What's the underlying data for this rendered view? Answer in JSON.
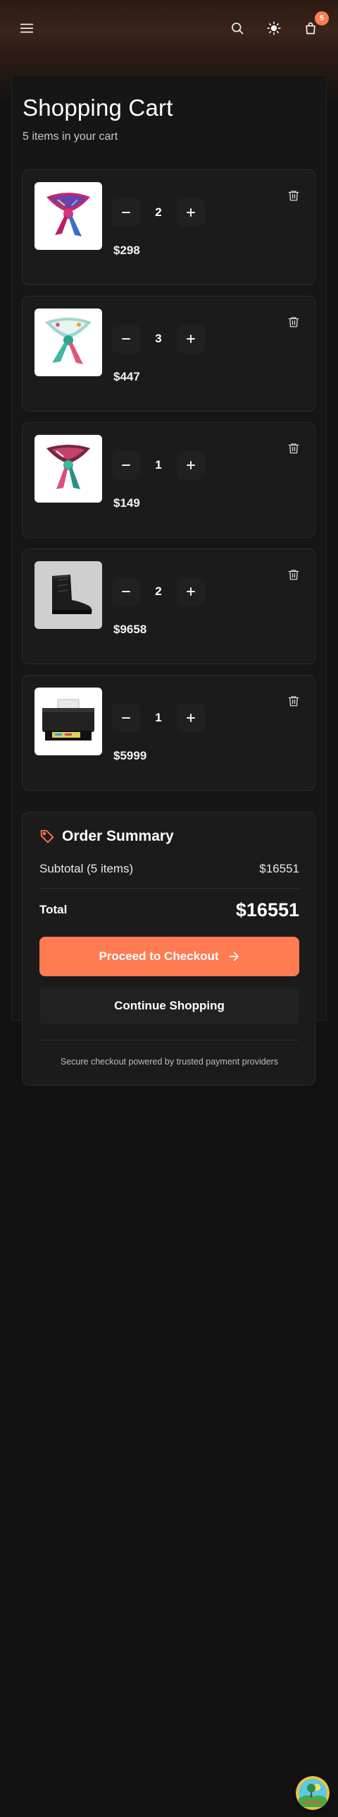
{
  "header": {
    "menu_icon": "menu-icon",
    "search_icon": "search-icon",
    "theme_icon": "sun-icon",
    "cart_icon": "shopping-bag-icon",
    "cart_count": "5"
  },
  "cart": {
    "title": "Shopping Cart",
    "subtitle": "5 items in your cart",
    "items": [
      {
        "image": "scarf-pink-icon",
        "quantity": "2",
        "price": "$298"
      },
      {
        "image": "scarf-teal-icon",
        "quantity": "3",
        "price": "$447"
      },
      {
        "image": "scarf-pink-icon",
        "quantity": "1",
        "price": "$149"
      },
      {
        "image": "boot-icon",
        "quantity": "2",
        "price": "$9658"
      },
      {
        "image": "printer-icon",
        "quantity": "1",
        "price": "$5999"
      }
    ]
  },
  "summary": {
    "title": "Order Summary",
    "subtotal_label": "Subtotal (5 items)",
    "subtotal_value": "$16551",
    "total_label": "Total",
    "total_value": "$16551",
    "checkout_label": "Proceed to Checkout",
    "continue_label": "Continue Shopping",
    "secure_note": "Secure checkout powered by trusted payment providers"
  },
  "colors": {
    "accent": "#ff7b52",
    "background": "#121212",
    "card": "#1b1b1b"
  }
}
